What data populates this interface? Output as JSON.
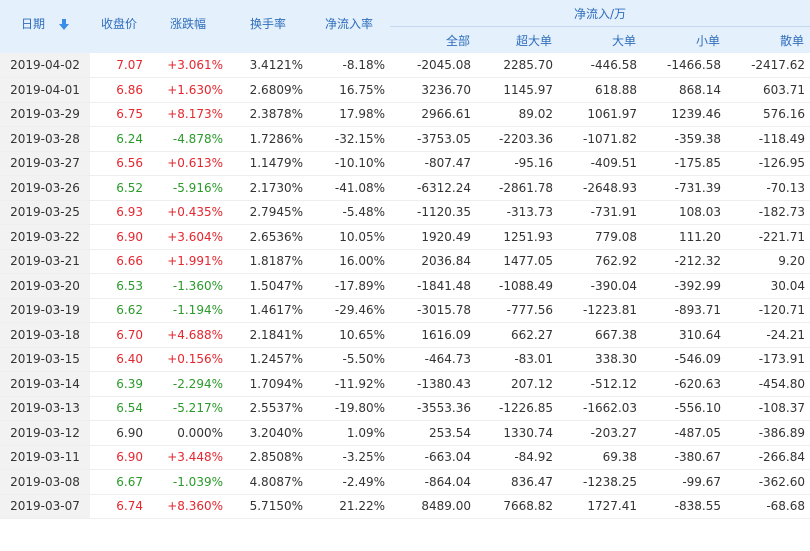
{
  "headers": {
    "date": "日期",
    "close": "收盘价",
    "change": "涨跌幅",
    "turnover": "换手率",
    "inflow_rate": "净流入率",
    "net_group": "净流入/万",
    "all": "全部",
    "super": "超大单",
    "large": "大单",
    "small": "小单",
    "retail": "散单"
  },
  "icons": {
    "sort": "arrow-down-icon"
  },
  "colors": {
    "up": "#e4272f",
    "down": "#2a9a2a",
    "header_bg": "#e4f0fc",
    "header_text": "#2f6ebd",
    "date_bg": "#f2f2f2"
  },
  "rows": [
    {
      "date": "2019-04-02",
      "close": "7.07",
      "change": "+3.061%",
      "turnover": "3.4121%",
      "rate": "-8.18%",
      "all": "-2045.08",
      "super": "2285.70",
      "large": "-446.58",
      "small": "-1466.58",
      "retail": "-2417.62",
      "trend": "up"
    },
    {
      "date": "2019-04-01",
      "close": "6.86",
      "change": "+1.630%",
      "turnover": "2.6809%",
      "rate": "16.75%",
      "all": "3236.70",
      "super": "1145.97",
      "large": "618.88",
      "small": "868.14",
      "retail": "603.71",
      "trend": "up"
    },
    {
      "date": "2019-03-29",
      "close": "6.75",
      "change": "+8.173%",
      "turnover": "2.3878%",
      "rate": "17.98%",
      "all": "2966.61",
      "super": "89.02",
      "large": "1061.97",
      "small": "1239.46",
      "retail": "576.16",
      "trend": "up"
    },
    {
      "date": "2019-03-28",
      "close": "6.24",
      "change": "-4.878%",
      "turnover": "1.7286%",
      "rate": "-32.15%",
      "all": "-3753.05",
      "super": "-2203.36",
      "large": "-1071.82",
      "small": "-359.38",
      "retail": "-118.49",
      "trend": "down"
    },
    {
      "date": "2019-03-27",
      "close": "6.56",
      "change": "+0.613%",
      "turnover": "1.1479%",
      "rate": "-10.10%",
      "all": "-807.47",
      "super": "-95.16",
      "large": "-409.51",
      "small": "-175.85",
      "retail": "-126.95",
      "trend": "up"
    },
    {
      "date": "2019-03-26",
      "close": "6.52",
      "change": "-5.916%",
      "turnover": "2.1730%",
      "rate": "-41.08%",
      "all": "-6312.24",
      "super": "-2861.78",
      "large": "-2648.93",
      "small": "-731.39",
      "retail": "-70.13",
      "trend": "down"
    },
    {
      "date": "2019-03-25",
      "close": "6.93",
      "change": "+0.435%",
      "turnover": "2.7945%",
      "rate": "-5.48%",
      "all": "-1120.35",
      "super": "-313.73",
      "large": "-731.91",
      "small": "108.03",
      "retail": "-182.73",
      "trend": "up"
    },
    {
      "date": "2019-03-22",
      "close": "6.90",
      "change": "+3.604%",
      "turnover": "2.6536%",
      "rate": "10.05%",
      "all": "1920.49",
      "super": "1251.93",
      "large": "779.08",
      "small": "111.20",
      "retail": "-221.71",
      "trend": "up"
    },
    {
      "date": "2019-03-21",
      "close": "6.66",
      "change": "+1.991%",
      "turnover": "1.8187%",
      "rate": "16.00%",
      "all": "2036.84",
      "super": "1477.05",
      "large": "762.92",
      "small": "-212.32",
      "retail": "9.20",
      "trend": "up"
    },
    {
      "date": "2019-03-20",
      "close": "6.53",
      "change": "-1.360%",
      "turnover": "1.5047%",
      "rate": "-17.89%",
      "all": "-1841.48",
      "super": "-1088.49",
      "large": "-390.04",
      "small": "-392.99",
      "retail": "30.04",
      "trend": "down"
    },
    {
      "date": "2019-03-19",
      "close": "6.62",
      "change": "-1.194%",
      "turnover": "1.4617%",
      "rate": "-29.46%",
      "all": "-3015.78",
      "super": "-777.56",
      "large": "-1223.81",
      "small": "-893.71",
      "retail": "-120.71",
      "trend": "down"
    },
    {
      "date": "2019-03-18",
      "close": "6.70",
      "change": "+4.688%",
      "turnover": "2.1841%",
      "rate": "10.65%",
      "all": "1616.09",
      "super": "662.27",
      "large": "667.38",
      "small": "310.64",
      "retail": "-24.21",
      "trend": "up"
    },
    {
      "date": "2019-03-15",
      "close": "6.40",
      "change": "+0.156%",
      "turnover": "1.2457%",
      "rate": "-5.50%",
      "all": "-464.73",
      "super": "-83.01",
      "large": "338.30",
      "small": "-546.09",
      "retail": "-173.91",
      "trend": "up"
    },
    {
      "date": "2019-03-14",
      "close": "6.39",
      "change": "-2.294%",
      "turnover": "1.7094%",
      "rate": "-11.92%",
      "all": "-1380.43",
      "super": "207.12",
      "large": "-512.12",
      "small": "-620.63",
      "retail": "-454.80",
      "trend": "down"
    },
    {
      "date": "2019-03-13",
      "close": "6.54",
      "change": "-5.217%",
      "turnover": "2.5537%",
      "rate": "-19.80%",
      "all": "-3553.36",
      "super": "-1226.85",
      "large": "-1662.03",
      "small": "-556.10",
      "retail": "-108.37",
      "trend": "down"
    },
    {
      "date": "2019-03-12",
      "close": "6.90",
      "change": "0.000%",
      "turnover": "3.2040%",
      "rate": "1.09%",
      "all": "253.54",
      "super": "1330.74",
      "large": "-203.27",
      "small": "-487.05",
      "retail": "-386.89",
      "trend": "flat"
    },
    {
      "date": "2019-03-11",
      "close": "6.90",
      "change": "+3.448%",
      "turnover": "2.8508%",
      "rate": "-3.25%",
      "all": "-663.04",
      "super": "-84.92",
      "large": "69.38",
      "small": "-380.67",
      "retail": "-266.84",
      "trend": "up"
    },
    {
      "date": "2019-03-08",
      "close": "6.67",
      "change": "-1.039%",
      "turnover": "4.8087%",
      "rate": "-2.49%",
      "all": "-864.04",
      "super": "836.47",
      "large": "-1238.25",
      "small": "-99.67",
      "retail": "-362.60",
      "trend": "down"
    },
    {
      "date": "2019-03-07",
      "close": "6.74",
      "change": "+8.360%",
      "turnover": "5.7150%",
      "rate": "21.22%",
      "all": "8489.00",
      "super": "7668.82",
      "large": "1727.41",
      "small": "-838.55",
      "retail": "-68.68",
      "trend": "up"
    }
  ]
}
